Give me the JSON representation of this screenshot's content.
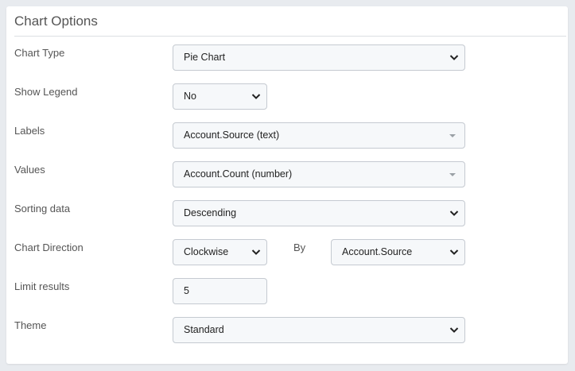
{
  "panel": {
    "title": "Chart Options"
  },
  "rows": {
    "chart_type": {
      "label": "Chart Type",
      "value": "Pie Chart"
    },
    "show_legend": {
      "label": "Show Legend",
      "value": "No"
    },
    "labels": {
      "label": "Labels",
      "value": "Account.Source (text)"
    },
    "values": {
      "label": "Values",
      "value": "Account.Count (number)"
    },
    "sorting": {
      "label": "Sorting data",
      "value": "Descending"
    },
    "direction": {
      "label": "Chart Direction",
      "value": "Clockwise",
      "by_label": "By",
      "by_value": "Account.Source"
    },
    "limit": {
      "label": "Limit results",
      "value": "5"
    },
    "theme": {
      "label": "Theme",
      "value": "Standard"
    }
  },
  "icons": {
    "select": "chevron-down-icon",
    "combobox": "caret-down-icon"
  }
}
